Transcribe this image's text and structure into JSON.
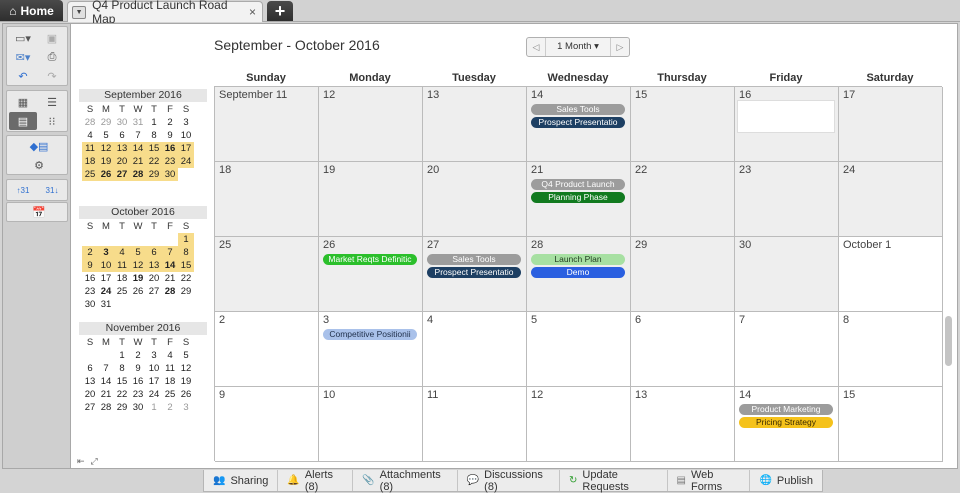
{
  "tabs": {
    "home_label": "Home",
    "doc_title": "Q4 Product Launch Road Map",
    "close_glyph": "×",
    "add_glyph": "+"
  },
  "toolbar": {
    "icons": [
      "new-sheet-icon",
      "save-icon",
      "email-icon",
      "print-icon",
      "undo-icon",
      "redo-icon",
      "grid-view-icon",
      "gantt-view-icon",
      "calendar-view-icon",
      "card-view-icon",
      "conditional-format-icon",
      "settings-icon",
      "week-start-sunday-icon",
      "week-start-monday-icon",
      "today-icon"
    ]
  },
  "minicals": [
    {
      "title": "September 2016",
      "headers": [
        "S",
        "M",
        "T",
        "W",
        "T",
        "F",
        "S"
      ],
      "days": [
        {
          "d": "28",
          "o": true
        },
        {
          "d": "29",
          "o": true
        },
        {
          "d": "30",
          "o": true
        },
        {
          "d": "31",
          "o": true
        },
        {
          "d": "1"
        },
        {
          "d": "2"
        },
        {
          "d": "3"
        },
        {
          "d": "4"
        },
        {
          "d": "5"
        },
        {
          "d": "6"
        },
        {
          "d": "7"
        },
        {
          "d": "8"
        },
        {
          "d": "9"
        },
        {
          "d": "10"
        },
        {
          "d": "11",
          "h": true
        },
        {
          "d": "12",
          "h": true
        },
        {
          "d": "13",
          "h": true
        },
        {
          "d": "14",
          "h": true
        },
        {
          "d": "15",
          "h": true
        },
        {
          "d": "16",
          "h": true,
          "b": true
        },
        {
          "d": "17",
          "h": true
        },
        {
          "d": "18",
          "h": true
        },
        {
          "d": "19",
          "h": true
        },
        {
          "d": "20",
          "h": true
        },
        {
          "d": "21",
          "h": true
        },
        {
          "d": "22",
          "h": true
        },
        {
          "d": "23",
          "h": true
        },
        {
          "d": "24",
          "h": true
        },
        {
          "d": "25",
          "h": true
        },
        {
          "d": "26",
          "h": true,
          "b": true
        },
        {
          "d": "27",
          "h": true,
          "b": true
        },
        {
          "d": "28",
          "h": true,
          "b": true
        },
        {
          "d": "29",
          "h": true
        },
        {
          "d": "30",
          "h": true
        }
      ]
    },
    {
      "title": "October 2016",
      "headers": [
        "S",
        "M",
        "T",
        "W",
        "T",
        "F",
        "S"
      ],
      "days": [
        {
          "d": ""
        },
        {
          "d": ""
        },
        {
          "d": ""
        },
        {
          "d": ""
        },
        {
          "d": ""
        },
        {
          "d": ""
        },
        {
          "d": "1",
          "h": true
        },
        {
          "d": "2",
          "h": true
        },
        {
          "d": "3",
          "h": true,
          "b": true
        },
        {
          "d": "4",
          "h": true
        },
        {
          "d": "5",
          "h": true
        },
        {
          "d": "6",
          "h": true
        },
        {
          "d": "7",
          "h": true
        },
        {
          "d": "8",
          "h": true
        },
        {
          "d": "9",
          "h": true
        },
        {
          "d": "10",
          "h": true
        },
        {
          "d": "11",
          "h": true
        },
        {
          "d": "12",
          "h": true
        },
        {
          "d": "13",
          "h": true
        },
        {
          "d": "14",
          "h": true,
          "b": true
        },
        {
          "d": "15",
          "h": true
        },
        {
          "d": "16"
        },
        {
          "d": "17"
        },
        {
          "d": "18"
        },
        {
          "d": "19",
          "b": true
        },
        {
          "d": "20"
        },
        {
          "d": "21"
        },
        {
          "d": "22"
        },
        {
          "d": "23"
        },
        {
          "d": "24",
          "b": true
        },
        {
          "d": "25"
        },
        {
          "d": "26"
        },
        {
          "d": "27"
        },
        {
          "d": "28",
          "b": true
        },
        {
          "d": "29"
        },
        {
          "d": "30"
        },
        {
          "d": "31"
        }
      ]
    },
    {
      "title": "November 2016",
      "headers": [
        "S",
        "M",
        "T",
        "W",
        "T",
        "F",
        "S"
      ],
      "days": [
        {
          "d": ""
        },
        {
          "d": ""
        },
        {
          "d": "1"
        },
        {
          "d": "2"
        },
        {
          "d": "3"
        },
        {
          "d": "4"
        },
        {
          "d": "5"
        },
        {
          "d": "6"
        },
        {
          "d": "7"
        },
        {
          "d": "8"
        },
        {
          "d": "9"
        },
        {
          "d": "10"
        },
        {
          "d": "11"
        },
        {
          "d": "12"
        },
        {
          "d": "13"
        },
        {
          "d": "14"
        },
        {
          "d": "15"
        },
        {
          "d": "16"
        },
        {
          "d": "17"
        },
        {
          "d": "18"
        },
        {
          "d": "19"
        },
        {
          "d": "20"
        },
        {
          "d": "21"
        },
        {
          "d": "22"
        },
        {
          "d": "23"
        },
        {
          "d": "24"
        },
        {
          "d": "25"
        },
        {
          "d": "26"
        },
        {
          "d": "27"
        },
        {
          "d": "28"
        },
        {
          "d": "29"
        },
        {
          "d": "30"
        },
        {
          "d": "1",
          "o": true
        },
        {
          "d": "2",
          "o": true
        },
        {
          "d": "3",
          "o": true
        }
      ]
    }
  ],
  "calendar": {
    "title": "September - October 2016",
    "view_label": "1 Month",
    "prev_glyph": "◁",
    "next_glyph": "▷",
    "weekdays": [
      "Sunday",
      "Monday",
      "Tuesday",
      "Wednesday",
      "Thursday",
      "Friday",
      "Saturday"
    ],
    "weeks": [
      [
        {
          "n": "September 11",
          "s": true
        },
        {
          "n": "12",
          "s": true
        },
        {
          "n": "13",
          "s": true
        },
        {
          "n": "14",
          "s": true
        },
        {
          "n": "15",
          "s": true
        },
        {
          "n": "16",
          "s": true,
          "blank": true
        },
        {
          "n": "17",
          "s": true
        }
      ],
      [
        {
          "n": "18",
          "s": true
        },
        {
          "n": "19",
          "s": true
        },
        {
          "n": "20",
          "s": true
        },
        {
          "n": "21",
          "s": true
        },
        {
          "n": "22",
          "s": true
        },
        {
          "n": "23",
          "s": true
        },
        {
          "n": "24",
          "s": true
        }
      ],
      [
        {
          "n": "25",
          "s": true
        },
        {
          "n": "26",
          "s": true
        },
        {
          "n": "27",
          "s": true
        },
        {
          "n": "28",
          "s": true
        },
        {
          "n": "29",
          "s": true
        },
        {
          "n": "30",
          "s": true
        },
        {
          "n": "October 1",
          "s": false
        }
      ],
      [
        {
          "n": "2"
        },
        {
          "n": "3"
        },
        {
          "n": "4"
        },
        {
          "n": "5"
        },
        {
          "n": "6"
        },
        {
          "n": "7"
        },
        {
          "n": "8"
        }
      ],
      [
        {
          "n": "9"
        },
        {
          "n": "10"
        },
        {
          "n": "11"
        },
        {
          "n": "12"
        },
        {
          "n": "13"
        },
        {
          "n": "14"
        },
        {
          "n": "15"
        }
      ]
    ],
    "events": [
      {
        "label": "Sales Tools",
        "week": 0,
        "day": 3,
        "slot": 0,
        "color": "#9c9c9c",
        "text": "#ffffff"
      },
      {
        "label": "Prospect Presentatio",
        "week": 0,
        "day": 3,
        "slot": 1,
        "color": "#1d3f63",
        "text": "#ffffff"
      },
      {
        "label": "Q4 Product Launch",
        "week": 1,
        "day": 3,
        "slot": 0,
        "color": "#9c9c9c",
        "text": "#ffffff"
      },
      {
        "label": "Planning Phase",
        "week": 1,
        "day": 3,
        "slot": 1,
        "color": "#117a1f",
        "text": "#ffffff"
      },
      {
        "label": "Market Reqts Definitic",
        "week": 2,
        "day": 1,
        "slot": 0,
        "color": "#2bbf2b",
        "text": "#ffffff"
      },
      {
        "label": "Sales Tools",
        "week": 2,
        "day": 2,
        "slot": 0,
        "color": "#9c9c9c",
        "text": "#ffffff"
      },
      {
        "label": "Prospect Presentatio",
        "week": 2,
        "day": 2,
        "slot": 1,
        "color": "#1d3f63",
        "text": "#ffffff"
      },
      {
        "label": "Launch Plan",
        "week": 2,
        "day": 3,
        "slot": 0,
        "color": "#a7e0a2",
        "text": "#1f3a1f"
      },
      {
        "label": "Demo",
        "week": 2,
        "day": 3,
        "slot": 1,
        "color": "#2a5fe0",
        "text": "#ffffff"
      },
      {
        "label": "Competitive Positionii",
        "week": 3,
        "day": 1,
        "slot": 0,
        "color": "#a9c1ea",
        "text": "#1f2f4a"
      },
      {
        "label": "Product Marketing",
        "week": 4,
        "day": 5,
        "slot": 0,
        "color": "#9c9c9c",
        "text": "#ffffff"
      },
      {
        "label": "Pricing Strategy",
        "week": 4,
        "day": 5,
        "slot": 1,
        "color": "#f5c21b",
        "text": "#3a2a00"
      }
    ]
  },
  "bottom_tabs": [
    {
      "label": "Sharing",
      "icon": "people-icon"
    },
    {
      "label": "Alerts (8)",
      "icon": "bell-icon"
    },
    {
      "label": "Attachments (8)",
      "icon": "paperclip-icon"
    },
    {
      "label": "Discussions (8)",
      "icon": "speech-bubble-icon"
    },
    {
      "label": "Update Requests",
      "icon": "update-request-icon"
    },
    {
      "label": "Web Forms",
      "icon": "web-form-icon"
    },
    {
      "label": "Publish",
      "icon": "globe-icon"
    }
  ]
}
